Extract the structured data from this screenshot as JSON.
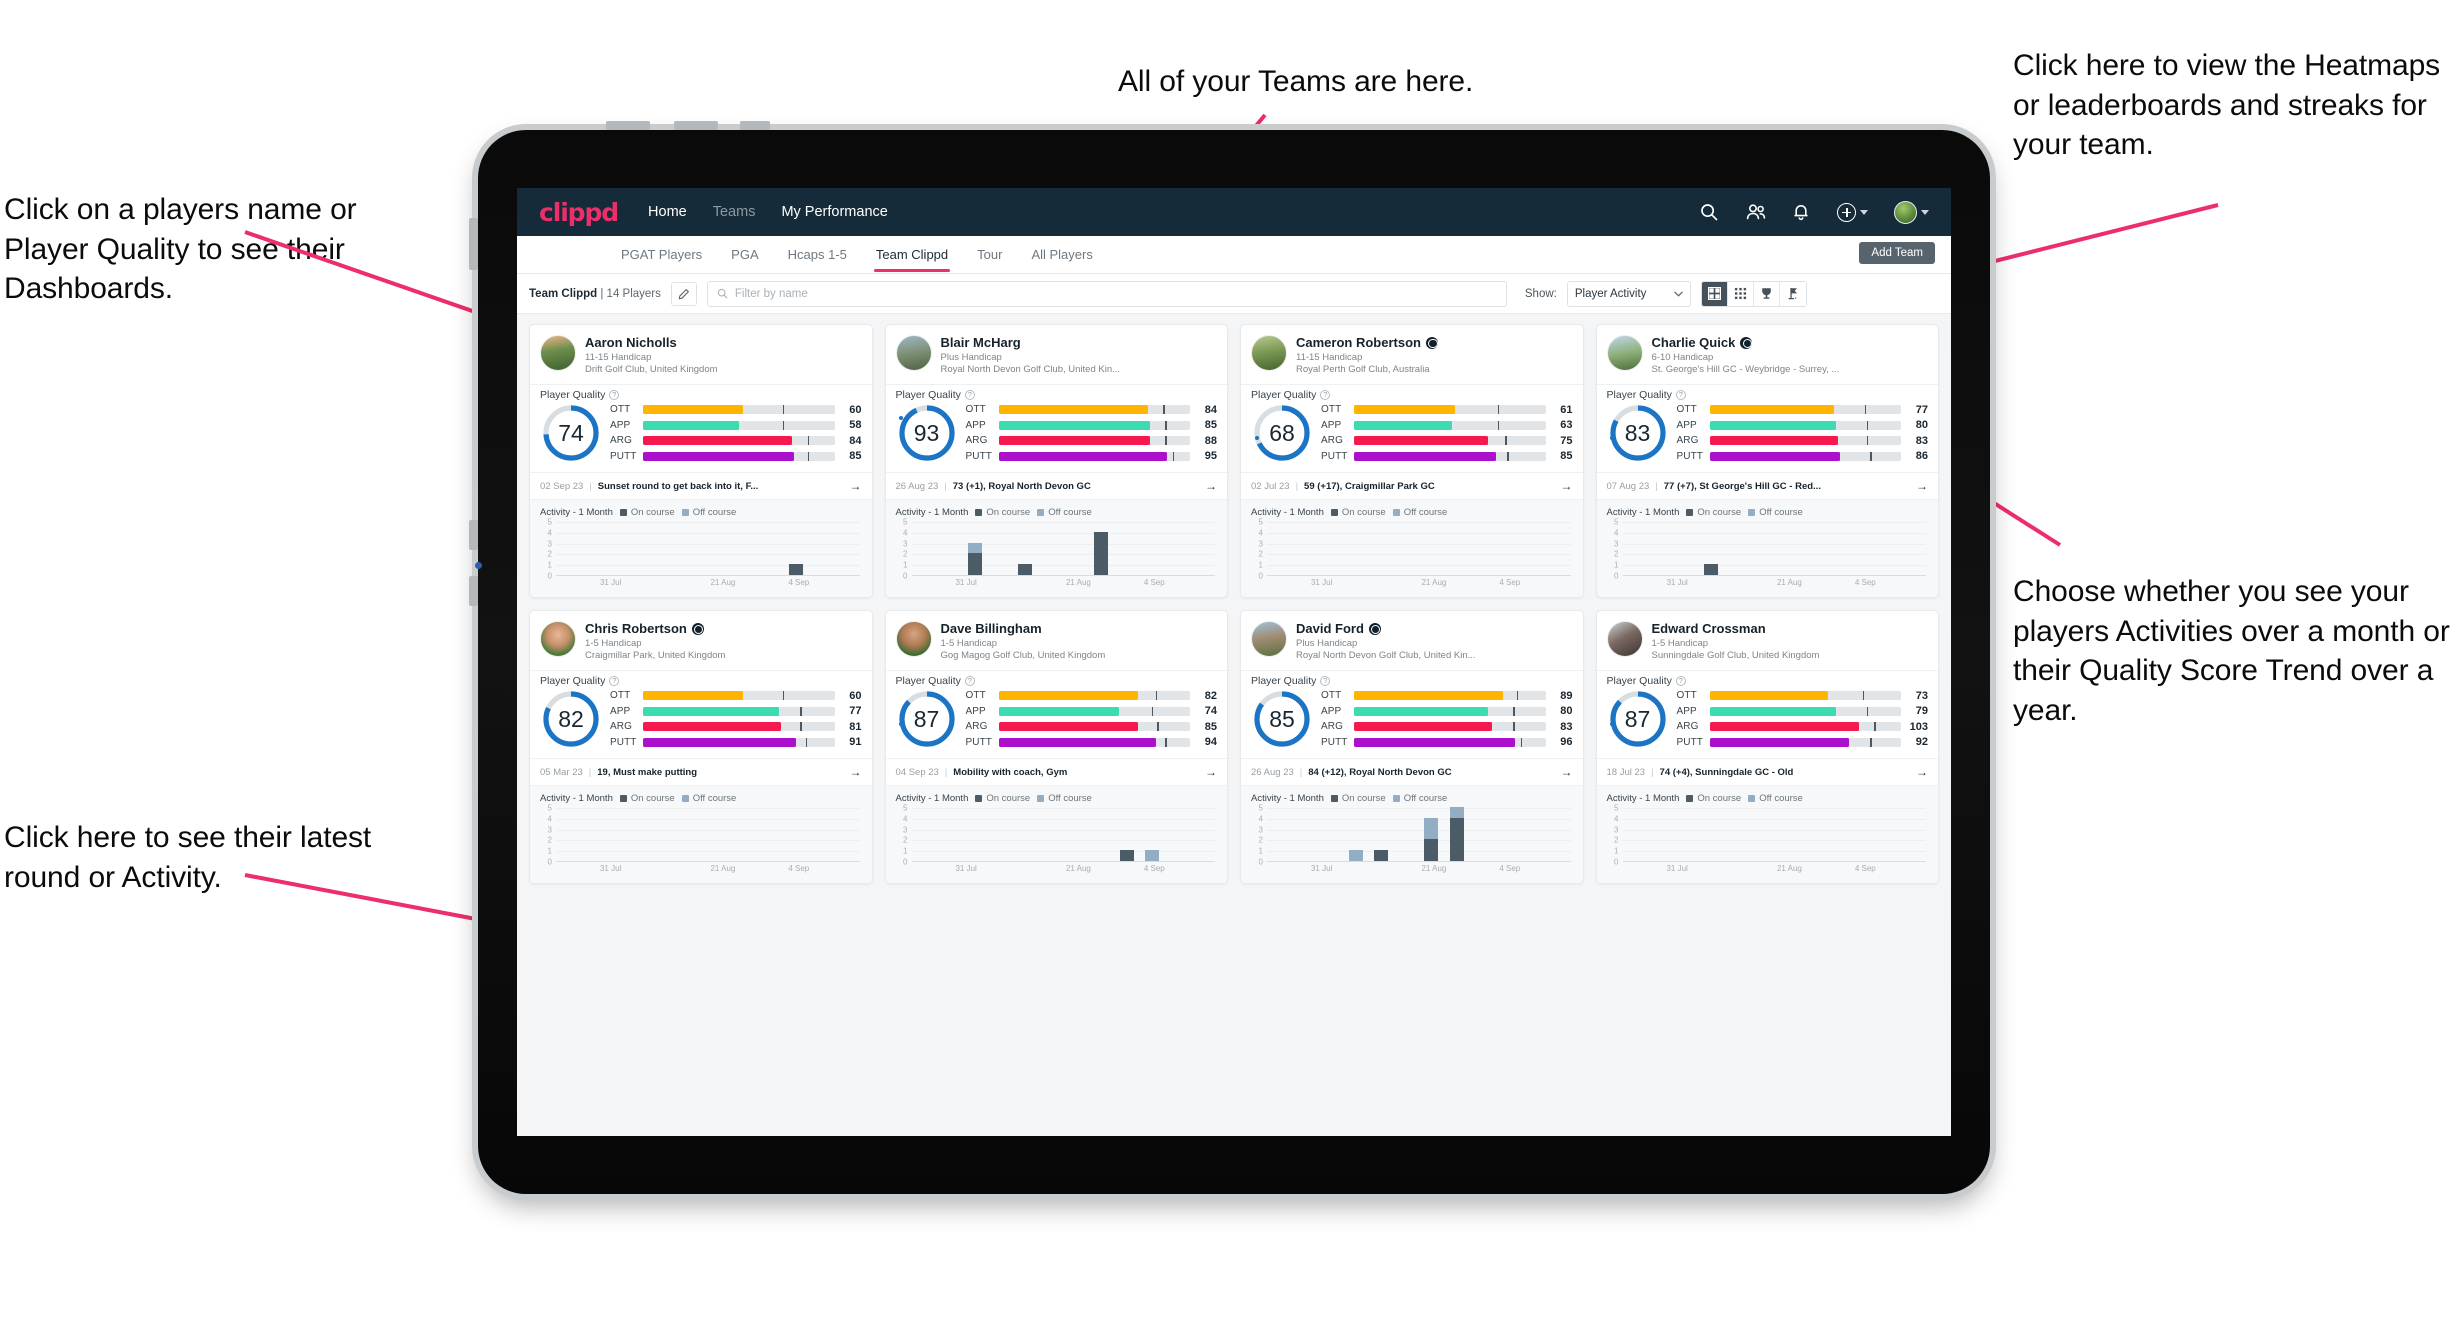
{
  "annotations": {
    "top_left": "Click on a players name or Player Quality to see their Dashboards.",
    "bottom_left": "Click here to see their latest round or Activity.",
    "top_center": "All of your Teams are here.",
    "top_right": "Click here to view the Heatmaps or leaderboards and streaks for your team.",
    "right_middle": "Choose whether you see your players Activities over a month or their Quality Score Trend over a year.",
    "arrow_color": "#ec2e6a"
  },
  "app": {
    "brand": "clippd",
    "nav_links": [
      {
        "label": "Home",
        "active": true
      },
      {
        "label": "Teams",
        "active": false
      },
      {
        "label": "My Performance",
        "active": true
      }
    ],
    "nav_icons": [
      "search-icon",
      "people-icon",
      "bell-icon",
      "plus-circle-icon",
      "avatar"
    ],
    "subtabs": [
      {
        "label": "PGAT Players",
        "active": false
      },
      {
        "label": "PGA",
        "active": false
      },
      {
        "label": "Hcaps 1-5",
        "active": false
      },
      {
        "label": "Team Clippd",
        "active": true
      },
      {
        "label": "Tour",
        "active": false
      },
      {
        "label": "All Players",
        "active": false
      }
    ],
    "add_team_label": "Add Team",
    "accent": "#ec2e6a",
    "navbar_bg": "#152b39"
  },
  "filterbar": {
    "team_name": "Team Clippd",
    "team_count": "| 14 Players",
    "edit_icon": "pencil-icon",
    "search_placeholder": "Filter by name",
    "search_value": "",
    "show_label": "Show:",
    "show_value": "Player Activity",
    "show_options": [
      "Player Activity",
      "Quality Score Trend"
    ],
    "view_buttons": [
      {
        "icon": "grid-view-icon",
        "active": true
      },
      {
        "icon": "table-view-icon",
        "active": false
      },
      {
        "icon": "trophy-icon",
        "active": false
      },
      {
        "icon": "flag-icon",
        "active": false
      }
    ]
  },
  "card_labels": {
    "player_quality": "Player Quality",
    "help_icon": "question-mark-icon",
    "activity_title": "Activity - 1 Month",
    "legend_on": "On course",
    "legend_off": "Off course",
    "arrow_icon": "arrow-right-icon",
    "metric_labels": [
      "OTT",
      "APP",
      "ARG",
      "PUTT"
    ],
    "metric_colors": [
      "#ffb400",
      "#3ddbb0",
      "#f5194f",
      "#ab11cc"
    ],
    "ring_color": "#1b74c4",
    "ring_track": "#d8dde1"
  },
  "chart_data": {
    "type": "bar",
    "title": "Activity - 1 Month",
    "ylabel": "",
    "xlabel": "",
    "ylim": [
      0,
      5
    ],
    "yticks": [
      0,
      1,
      2,
      3,
      4,
      5
    ],
    "xticks": [
      "31 Jul",
      "21 Aug",
      "4 Sep"
    ],
    "grid": true,
    "legend": [
      "On course",
      "Off course"
    ],
    "series_colors": {
      "On course": "#4c5c67",
      "Off course": "#93aec4"
    },
    "per_player": [
      {
        "player": "Aaron Nicholls",
        "on_course": [
          0,
          0,
          0,
          0,
          0,
          0,
          0,
          0,
          0,
          1,
          0,
          0
        ],
        "off_course": [
          0,
          0,
          0,
          0,
          0,
          0,
          0,
          0,
          0,
          0,
          0,
          0
        ]
      },
      {
        "player": "Blair McHarg",
        "on_course": [
          0,
          0,
          2,
          0,
          1,
          0,
          0,
          4,
          0,
          0,
          0,
          0
        ],
        "off_course": [
          0,
          0,
          1,
          0,
          0,
          0,
          0,
          0,
          0,
          0,
          0,
          0
        ]
      },
      {
        "player": "Cameron Robertson",
        "on_course": [
          0,
          0,
          0,
          0,
          0,
          0,
          0,
          0,
          0,
          0,
          0,
          0
        ],
        "off_course": [
          0,
          0,
          0,
          0,
          0,
          0,
          0,
          0,
          0,
          0,
          0,
          0
        ]
      },
      {
        "player": "Charlie Quick",
        "on_course": [
          0,
          0,
          0,
          1,
          0,
          0,
          0,
          0,
          0,
          0,
          0,
          0
        ],
        "off_course": [
          0,
          0,
          0,
          0,
          0,
          0,
          0,
          0,
          0,
          0,
          0,
          0
        ]
      },
      {
        "player": "Chris Robertson",
        "on_course": [
          0,
          0,
          0,
          0,
          0,
          0,
          0,
          0,
          0,
          0,
          0,
          0
        ],
        "off_course": [
          0,
          0,
          0,
          0,
          0,
          0,
          0,
          0,
          0,
          0,
          0,
          0
        ]
      },
      {
        "player": "Dave Billingham",
        "on_course": [
          0,
          0,
          0,
          0,
          0,
          0,
          0,
          0,
          1,
          0,
          0,
          0
        ],
        "off_course": [
          0,
          0,
          0,
          0,
          0,
          0,
          0,
          0,
          0,
          1,
          0,
          0
        ]
      },
      {
        "player": "David Ford",
        "on_course": [
          0,
          0,
          0,
          0,
          1,
          0,
          2,
          4,
          0,
          0,
          0,
          0
        ],
        "off_course": [
          0,
          0,
          0,
          1,
          0,
          0,
          2,
          1,
          0,
          0,
          0,
          0
        ]
      },
      {
        "player": "Edward Crossman",
        "on_course": [
          0,
          0,
          0,
          0,
          0,
          0,
          0,
          0,
          0,
          0,
          0,
          0
        ],
        "off_course": [
          0,
          0,
          0,
          0,
          0,
          0,
          0,
          0,
          0,
          0,
          0,
          0
        ]
      }
    ]
  },
  "players": [
    {
      "name": "Aaron Nicholls",
      "verified": false,
      "avatar": "av0",
      "handicap": "11-15 Handicap",
      "club": "Drift Golf Club, United Kingdom",
      "quality": 74,
      "metrics": [
        {
          "label": "OTT",
          "value": 60,
          "fill": 52,
          "tick": 73
        },
        {
          "label": "APP",
          "value": 58,
          "fill": 50,
          "tick": 73
        },
        {
          "label": "ARG",
          "value": 84,
          "fill": 78,
          "tick": 86
        },
        {
          "label": "PUTT",
          "value": 85,
          "fill": 79,
          "tick": 86
        }
      ],
      "latest_date": "02 Sep 23",
      "latest_text": "Sunset round to get back into it, F...",
      "chart_index": 0
    },
    {
      "name": "Blair McHarg",
      "verified": false,
      "avatar": "av1",
      "handicap": "Plus Handicap",
      "club": "Royal North Devon Golf Club, United Kin...",
      "quality": 93,
      "metrics": [
        {
          "label": "OTT",
          "value": 84,
          "fill": 78,
          "tick": 86
        },
        {
          "label": "APP",
          "value": 85,
          "fill": 79,
          "tick": 87
        },
        {
          "label": "ARG",
          "value": 88,
          "fill": 79,
          "tick": 87
        },
        {
          "label": "PUTT",
          "value": 95,
          "fill": 88,
          "tick": 91
        }
      ],
      "latest_date": "26 Aug 23",
      "latest_text": "73 (+1), Royal North Devon GC",
      "chart_index": 1
    },
    {
      "name": "Cameron Robertson",
      "verified": true,
      "avatar": "av2",
      "handicap": "11-15 Handicap",
      "club": "Royal Perth Golf Club, Australia",
      "quality": 68,
      "metrics": [
        {
          "label": "OTT",
          "value": 61,
          "fill": 53,
          "tick": 75
        },
        {
          "label": "APP",
          "value": 63,
          "fill": 51,
          "tick": 75
        },
        {
          "label": "ARG",
          "value": 75,
          "fill": 70,
          "tick": 79
        },
        {
          "label": "PUTT",
          "value": 85,
          "fill": 74,
          "tick": 80
        }
      ],
      "latest_date": "02 Jul 23",
      "latest_text": "59 (+17), Craigmillar Park GC",
      "chart_index": 2
    },
    {
      "name": "Charlie Quick",
      "verified": true,
      "avatar": "av3",
      "handicap": "6-10 Handicap",
      "club": "St. George's Hill GC - Weybridge - Surrey, ...",
      "quality": 83,
      "metrics": [
        {
          "label": "OTT",
          "value": 77,
          "fill": 65,
          "tick": 81
        },
        {
          "label": "APP",
          "value": 80,
          "fill": 66,
          "tick": 82
        },
        {
          "label": "ARG",
          "value": 83,
          "fill": 67,
          "tick": 82
        },
        {
          "label": "PUTT",
          "value": 86,
          "fill": 68,
          "tick": 84
        }
      ],
      "latest_date": "07 Aug 23",
      "latest_text": "77 (+7), St George's Hill GC - Red...",
      "chart_index": 3
    },
    {
      "name": "Chris Robertson",
      "verified": true,
      "avatar": "av4",
      "handicap": "1-5 Handicap",
      "club": "Craigmillar Park, United Kingdom",
      "quality": 82,
      "metrics": [
        {
          "label": "OTT",
          "value": 60,
          "fill": 52,
          "tick": 73
        },
        {
          "label": "APP",
          "value": 77,
          "fill": 71,
          "tick": 82
        },
        {
          "label": "ARG",
          "value": 81,
          "fill": 72,
          "tick": 82
        },
        {
          "label": "PUTT",
          "value": 91,
          "fill": 80,
          "tick": 85
        }
      ],
      "latest_date": "05 Mar 23",
      "latest_text": "19, Must make putting",
      "chart_index": 4
    },
    {
      "name": "Dave Billingham",
      "verified": false,
      "avatar": "av5",
      "handicap": "1-5 Handicap",
      "club": "Gog Magog Golf Club, United Kingdom",
      "quality": 87,
      "metrics": [
        {
          "label": "OTT",
          "value": 82,
          "fill": 73,
          "tick": 82
        },
        {
          "label": "APP",
          "value": 74,
          "fill": 63,
          "tick": 80
        },
        {
          "label": "ARG",
          "value": 85,
          "fill": 73,
          "tick": 83
        },
        {
          "label": "PUTT",
          "value": 94,
          "fill": 82,
          "tick": 87
        }
      ],
      "latest_date": "04 Sep 23",
      "latest_text": "Mobility with coach, Gym",
      "chart_index": 5
    },
    {
      "name": "David Ford",
      "verified": true,
      "avatar": "av6",
      "handicap": "Plus Handicap",
      "club": "Royal North Devon Golf Club, United Kin...",
      "quality": 85,
      "metrics": [
        {
          "label": "OTT",
          "value": 89,
          "fill": 78,
          "tick": 85
        },
        {
          "label": "APP",
          "value": 80,
          "fill": 70,
          "tick": 83
        },
        {
          "label": "ARG",
          "value": 83,
          "fill": 72,
          "tick": 83
        },
        {
          "label": "PUTT",
          "value": 96,
          "fill": 84,
          "tick": 87
        }
      ],
      "latest_date": "26 Aug 23",
      "latest_text": "84 (+12), Royal North Devon GC",
      "chart_index": 6
    },
    {
      "name": "Edward Crossman",
      "verified": false,
      "avatar": "av7",
      "handicap": "1-5 Handicap",
      "club": "Sunningdale Golf Club, United Kingdom",
      "quality": 87,
      "metrics": [
        {
          "label": "OTT",
          "value": 73,
          "fill": 62,
          "tick": 80
        },
        {
          "label": "APP",
          "value": 79,
          "fill": 66,
          "tick": 82
        },
        {
          "label": "ARG",
          "value": 103,
          "fill": 78,
          "tick": 86
        },
        {
          "label": "PUTT",
          "value": 92,
          "fill": 73,
          "tick": 84
        }
      ],
      "latest_date": "18 Jul 23",
      "latest_text": "74 (+4), Sunningdale GC - Old",
      "chart_index": 7
    }
  ]
}
